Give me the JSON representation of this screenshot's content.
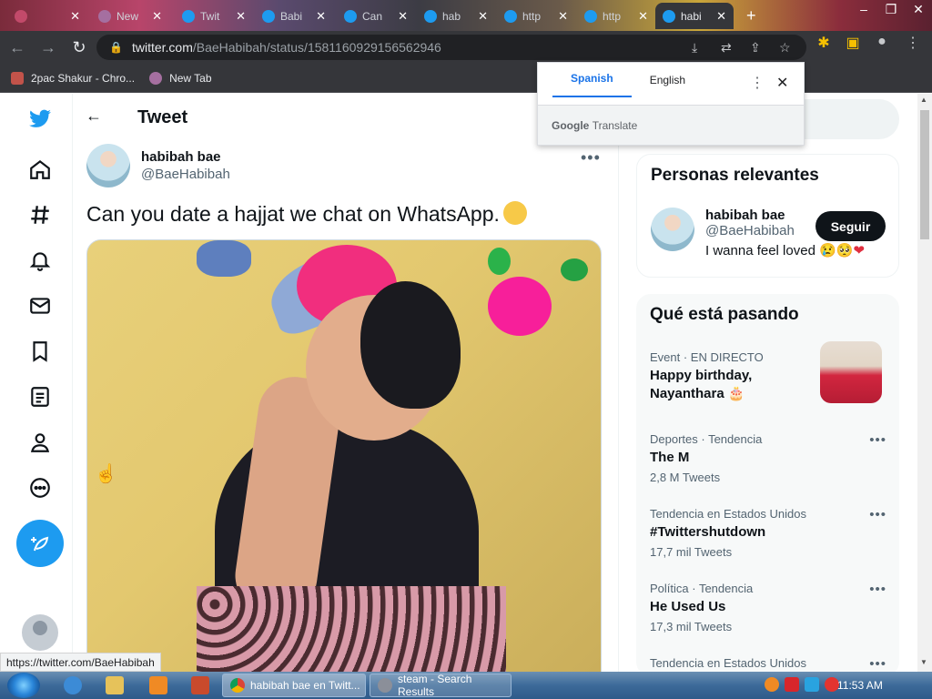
{
  "browser": {
    "tabs": [
      {
        "label": ""
      },
      {
        "label": "New"
      },
      {
        "label": "Twit"
      },
      {
        "label": "Babi"
      },
      {
        "label": "Can"
      },
      {
        "label": "hab"
      },
      {
        "label": "http"
      },
      {
        "label": "http"
      },
      {
        "label": "habi",
        "active": true
      }
    ],
    "new_tab_label": "+",
    "url_host": "twitter.com",
    "url_path": "/BaeHabibah/status/1581160929156562946",
    "bookmarks": [
      {
        "label": "2pac Shakur - Chro..."
      },
      {
        "label": "New Tab"
      }
    ],
    "status_url": "https://twitter.com/BaeHabibah"
  },
  "translate_popup": {
    "lang_source": "Spanish",
    "lang_target": "English",
    "brand_google": "Google",
    "brand_translate": "Translate"
  },
  "tweet": {
    "header_title": "Tweet",
    "author_name": "habibah bae",
    "author_handle": "@BaeHabibah",
    "text": "Can you date a hajjat we chat on WhatsApp."
  },
  "relevant": {
    "title": "Personas relevantes",
    "name": "habibah bae",
    "handle": "@BaeHabibah",
    "bio": "I wanna feel loved",
    "follow_label": "Seguir"
  },
  "trends": {
    "title": "Qué está pasando",
    "items": [
      {
        "category": "Event · EN DIRECTO",
        "title": "Happy birthday, Nayanthara",
        "count": ""
      },
      {
        "category": "Deportes · Tendencia",
        "title": "The M",
        "count": "2,8 M Tweets"
      },
      {
        "category": "Tendencia en Estados Unidos",
        "title": "#Twittershutdown",
        "count": "17,7 mil Tweets"
      },
      {
        "category": "Política · Tendencia",
        "title": "He Used Us",
        "count": "17,3 mil Tweets"
      },
      {
        "category": "Tendencia en Estados Unidos",
        "title": "",
        "count": ""
      }
    ]
  },
  "taskbar": {
    "windows": [
      {
        "label": "habibah bae en Twitt..."
      },
      {
        "label": "steam - Search Results"
      }
    ],
    "clock": "11:53 AM"
  },
  "colors": {
    "twitter_blue": "#1d9bf0",
    "text_primary": "#0f1419",
    "text_secondary": "#536471"
  }
}
